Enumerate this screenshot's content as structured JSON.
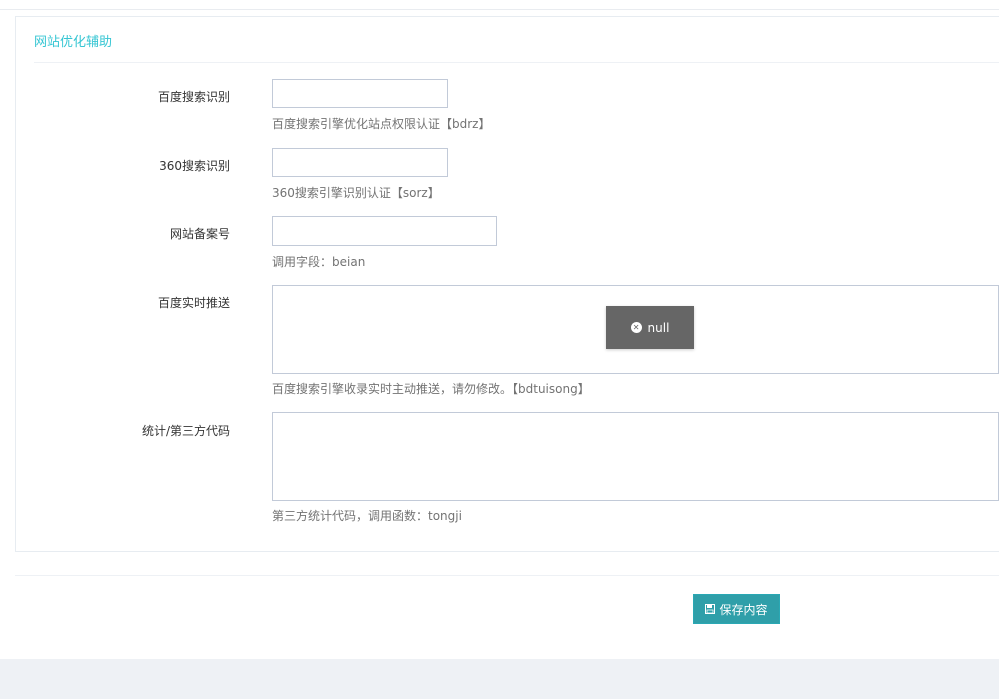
{
  "panel": {
    "title": "网站优化辅助"
  },
  "fields": [
    {
      "label": "百度搜索识别",
      "value": "",
      "help": "百度搜索引擎优化站点权限认证【bdrz】"
    },
    {
      "label": "360搜索识别",
      "value": "",
      "help": "360搜索引擎识别认证【sorz】"
    },
    {
      "label": "网站备案号",
      "value": "",
      "help": "调用字段：beian"
    },
    {
      "label": "百度实时推送",
      "value": "",
      "help": "百度搜索引擎收录实时主动推送，请勿修改。【bdtuisong】"
    },
    {
      "label": "统计/第三方代码",
      "value": "",
      "help": "第三方统计代码，调用函数：tongji"
    }
  ],
  "toast": {
    "icon": "close-circle-icon",
    "text": "null"
  },
  "actions": {
    "save_label": "保存内容",
    "save_icon": "floppy-disk-icon"
  },
  "colors": {
    "accent": "#36c6d3",
    "button": "#2f9fa9",
    "toast_bg": "#666666"
  }
}
